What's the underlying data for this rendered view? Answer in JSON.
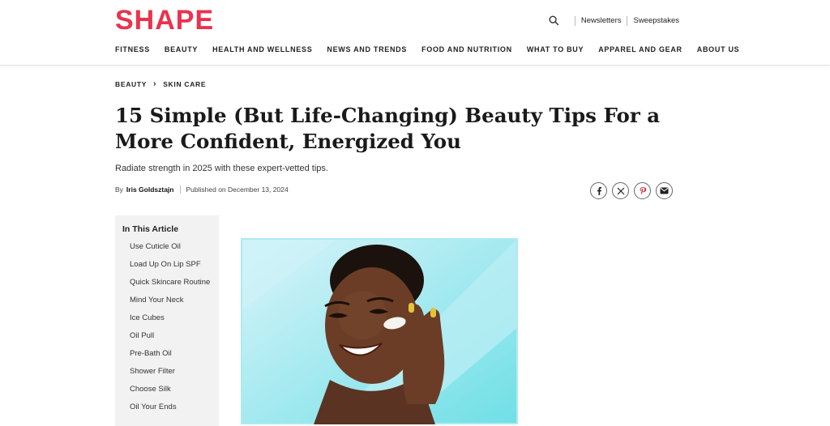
{
  "brand": {
    "logo": "SHAPE",
    "accent": "#e8334f"
  },
  "utility": {
    "search_icon": "search-icon",
    "newsletters": "Newsletters",
    "sweepstakes": "Sweepstakes"
  },
  "nav": {
    "items": [
      "FITNESS",
      "BEAUTY",
      "HEALTH AND WELLNESS",
      "NEWS AND TRENDS",
      "FOOD AND NUTRITION",
      "WHAT TO BUY",
      "APPAREL AND GEAR",
      "ABOUT US"
    ]
  },
  "breadcrumb": {
    "items": [
      "BEAUTY",
      "SKIN CARE"
    ]
  },
  "article": {
    "title": "15 Simple (But Life-Changing) Beauty Tips For a More Confident, Energized You",
    "subtitle": "Radiate strength in 2025 with these expert-vetted tips.",
    "by_label": "By",
    "author": "Iris Goldsztajn",
    "published": "Published on December 13, 2024"
  },
  "share": {
    "icons": [
      "facebook-icon",
      "x-icon",
      "pinterest-icon",
      "email-icon"
    ]
  },
  "toc": {
    "title": "In This Article",
    "items": [
      "Use Cuticle Oil",
      "Load Up On Lip SPF",
      "Quick Skincare Routine",
      "Mind Your Neck",
      "Ice Cubes",
      "Oil Pull",
      "Pre-Bath Oil",
      "Shower Filter",
      "Choose Silk",
      "Oil Your Ends"
    ]
  }
}
